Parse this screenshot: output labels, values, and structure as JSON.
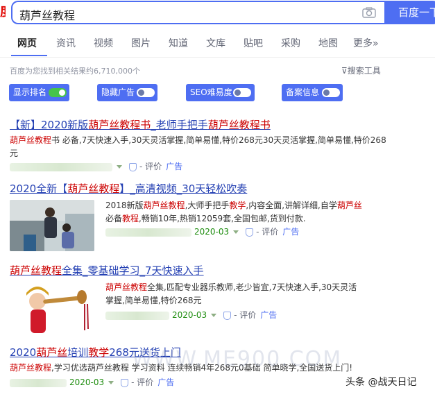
{
  "search": {
    "query": "葫芦丝教程",
    "button": "百度一下"
  },
  "tabs": [
    "网页",
    "资讯",
    "视频",
    "图片",
    "知道",
    "文库",
    "贴吧",
    "采购",
    "地图",
    "更多»"
  ],
  "result_count": "百度为您找到相关结果约6,710,000个",
  "tools_label": "搜索工具",
  "toggles": [
    {
      "label": "显示排名",
      "state": "on"
    },
    {
      "label": "隐藏广告",
      "state": "off"
    },
    {
      "label": "SEO难易度",
      "state": "off"
    },
    {
      "label": "备案信息",
      "state": "off"
    }
  ],
  "results": [
    {
      "title_parts": [
        "【新】2020新版",
        "葫芦丝教程书",
        "_老师手把手",
        "葫芦丝教程书"
      ],
      "desc_parts": [
        "葫芦丝教程",
        "书 必备,7天快速入手,30天灵活掌握,简单易懂,特价268元30天灵活掌握,简单易懂,特价268元"
      ],
      "meta_pj": "- 评价",
      "meta_ad": "广告"
    },
    {
      "title_parts": [
        "2020全新【",
        "葫芦丝教程",
        "】_高清视频_30天轻松吹奏"
      ],
      "desc_line1": [
        "2018新版",
        "葫芦丝教程",
        ",大师手把手",
        "教学",
        ",内容全面,讲解详细,自学",
        "葫芦丝"
      ],
      "desc_line2": [
        "必备",
        "教程",
        ",畅销10年,热销12059套,全国包邮,货到付款."
      ],
      "meta_date": "2020-03",
      "meta_pj": "- 评价",
      "meta_ad": "广告"
    },
    {
      "title_parts": [
        "葫芦丝教程",
        "全集_零基础学习_7天快速入手"
      ],
      "desc_line1": [
        "葫芦丝教程",
        "全集,匹配专业器乐教师,老少皆宜,7天快速入手,30天灵活"
      ],
      "desc_line2": "掌握,简单易懂,特价268元",
      "meta_date": "2020-03",
      "meta_pj": "- 评价",
      "meta_ad": "广告"
    },
    {
      "title_parts": [
        "2020",
        "葫芦丝",
        "培训",
        "教学",
        "268元送货上门"
      ],
      "desc_parts": [
        "葫芦丝教程",
        ",学习优选葫芦丝教程 学习资料 连续畅销4年268元0基础 简单晓学,全国送货上门!"
      ],
      "meta_date": "2020-03",
      "meta_pj": "- 评价",
      "meta_ad": "广告"
    }
  ],
  "watermark": "WWW.ME900.COM",
  "credit": "头条 @战天日记"
}
